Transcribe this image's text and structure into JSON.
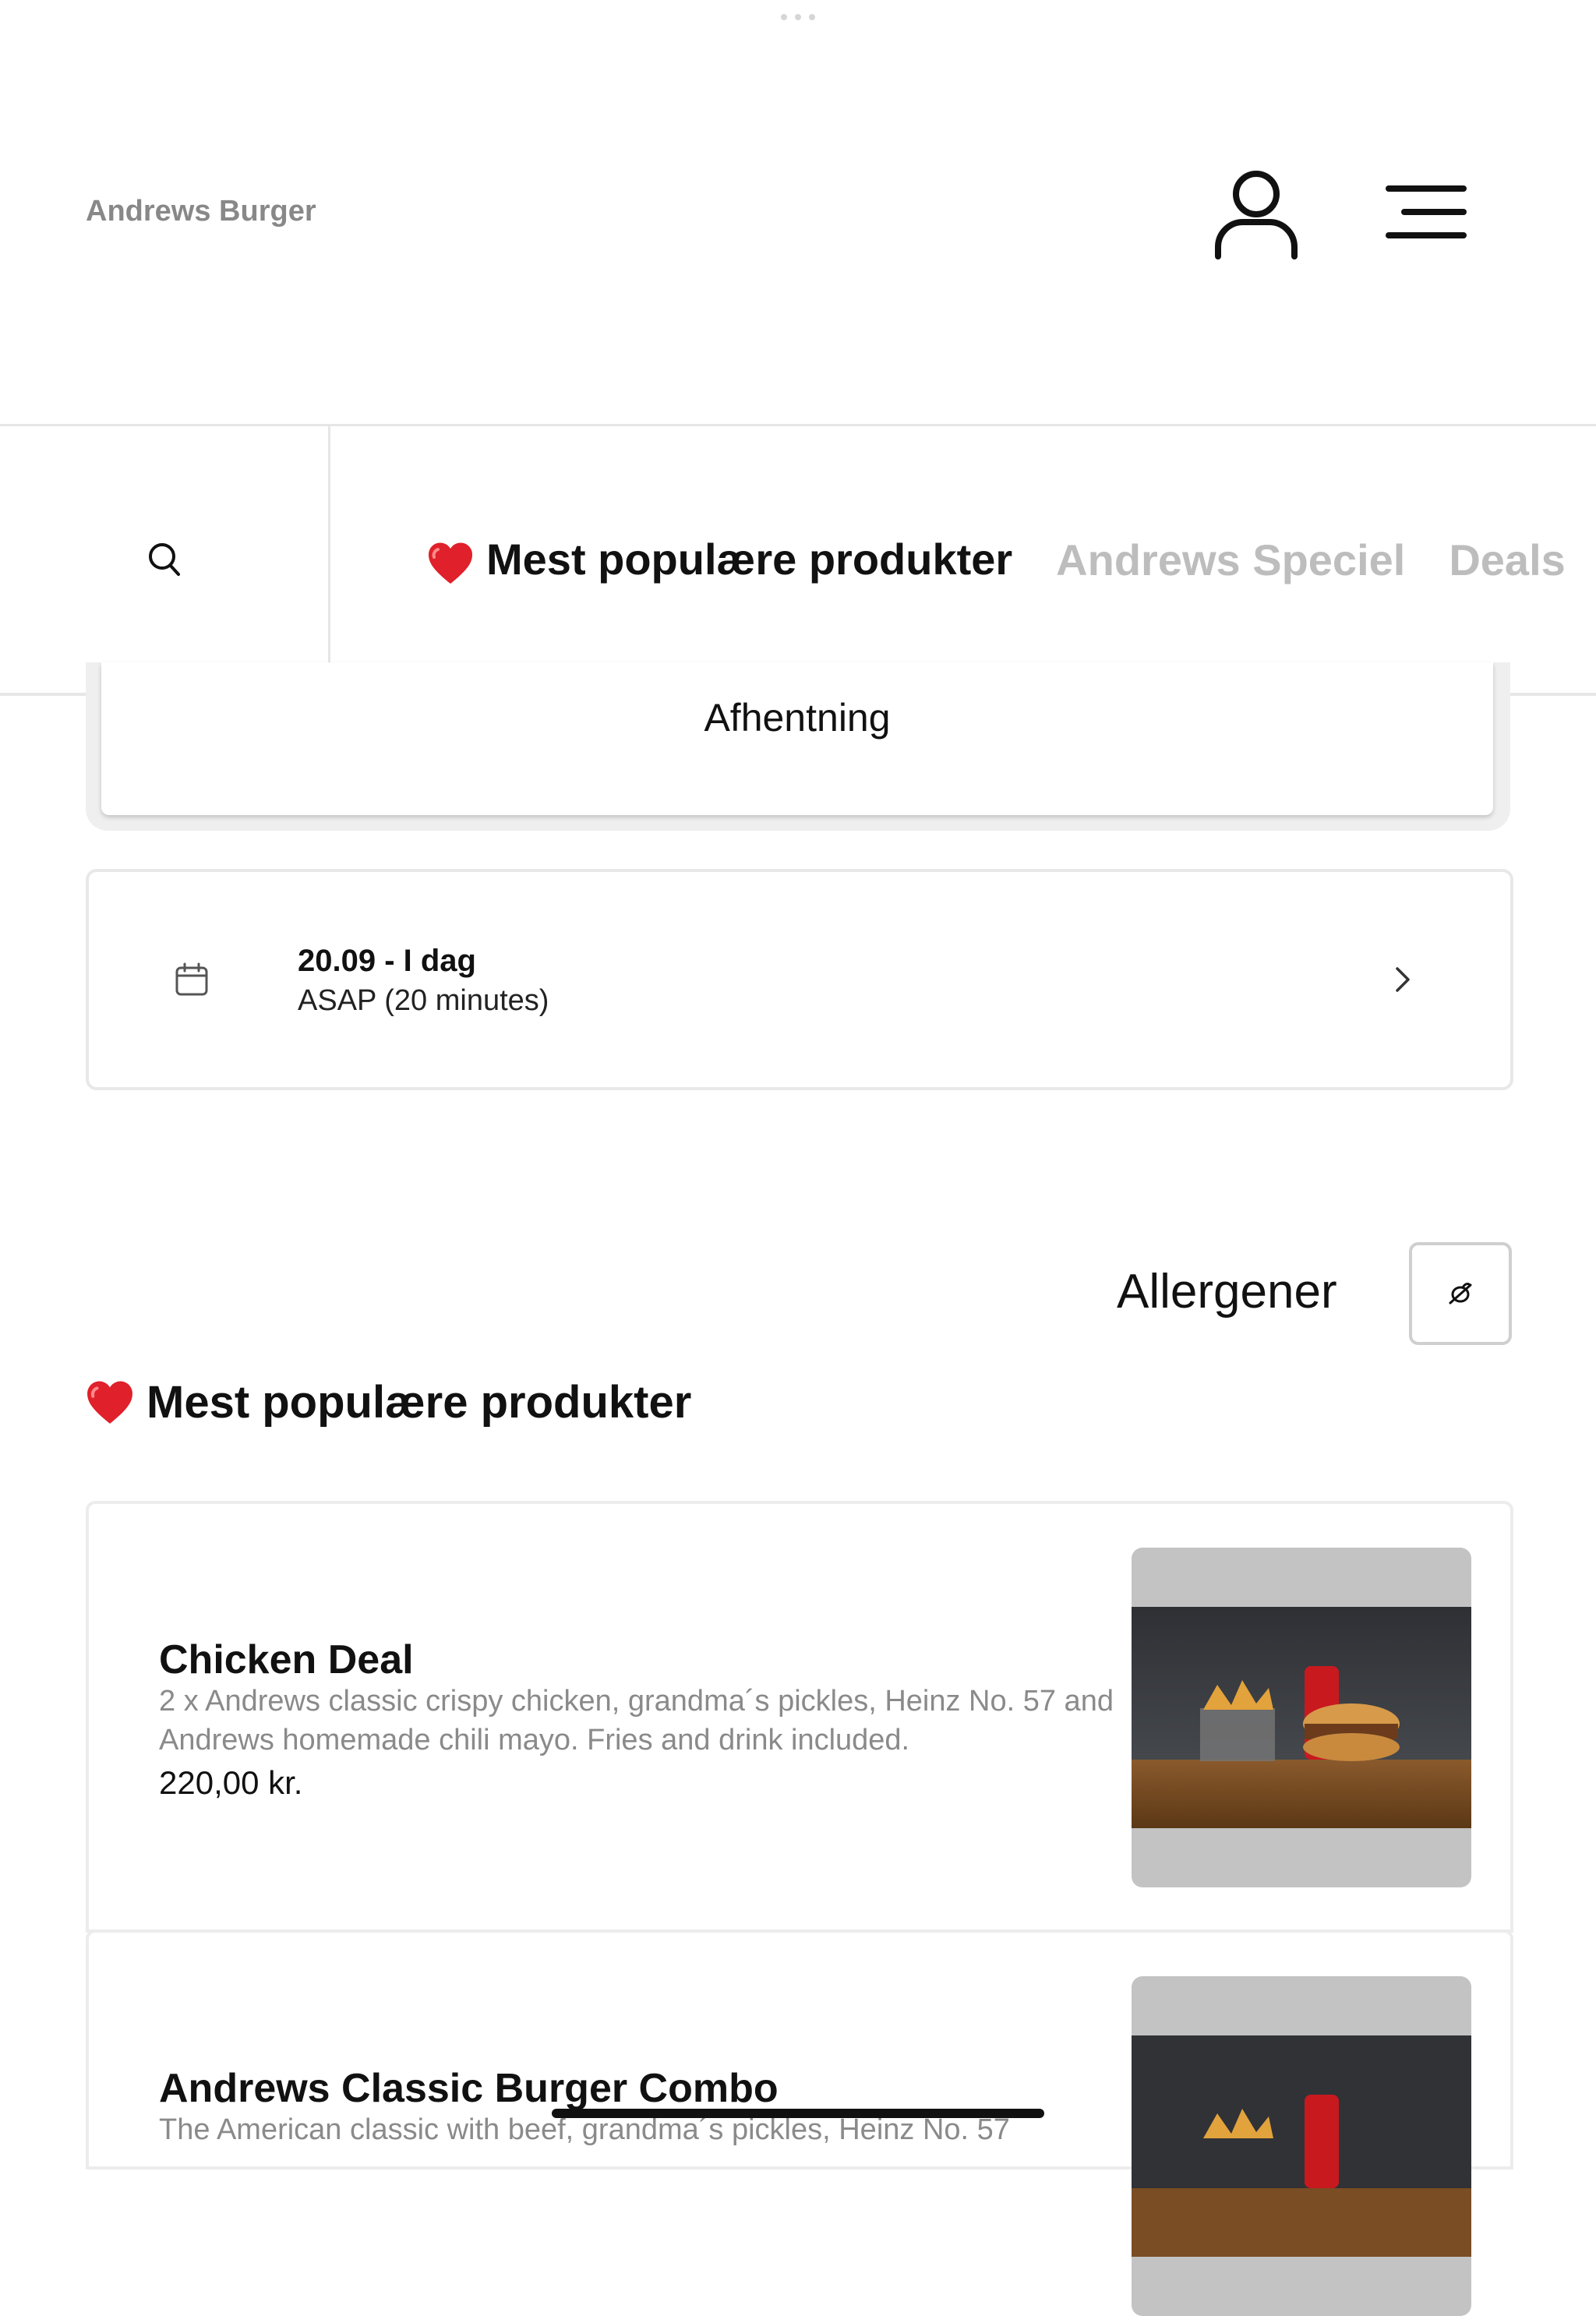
{
  "header": {
    "brand": "Andrews Burger",
    "user_icon": "user-icon",
    "menu_icon": "hamburger-menu-icon"
  },
  "category_bar": {
    "search_icon": "search-icon",
    "tabs": [
      {
        "label": "Mest populære produkter",
        "active": true,
        "icon": "heart-icon"
      },
      {
        "label": "Andrews Speciel",
        "active": false
      },
      {
        "label": "Deals",
        "active": false
      }
    ]
  },
  "order_type": {
    "label": "Afhentning"
  },
  "time_selector": {
    "date": "20.09 - I dag",
    "time": "ASAP (20 minutes)",
    "calendar_icon": "calendar-icon",
    "chevron_icon": "chevron-right-icon"
  },
  "allergens": {
    "label": "Allergener",
    "icon": "allergen-filter-icon"
  },
  "section": {
    "title": "Mest populære produkter",
    "icon": "heart-icon"
  },
  "products": [
    {
      "name": "Chicken Deal",
      "description": "2 x Andrews classic crispy chicken, grandma´s pickles, Heinz No. 57 and Andrews homemade chili mayo. Fries and drink included.",
      "price": "220,00 kr."
    },
    {
      "name": "Andrews Classic Burger Combo",
      "description": "The American classic with beef, grandma´s pickles, Heinz No. 57",
      "price": ""
    }
  ],
  "colors": {
    "text": "#111111",
    "muted": "#888888",
    "inactive_tab": "#bdbdbd",
    "border": "#e6e6e6",
    "heart": "#e0202a"
  }
}
